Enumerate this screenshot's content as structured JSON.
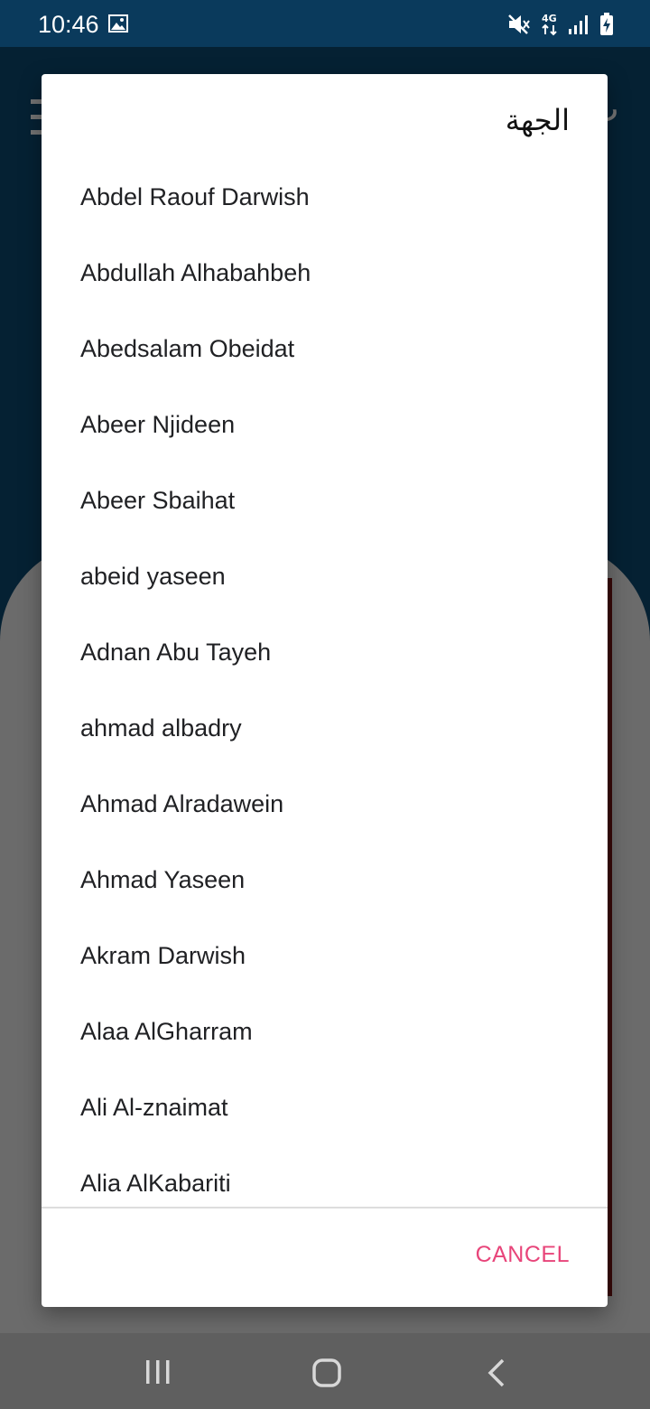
{
  "status": {
    "time": "10:46",
    "network": "4G"
  },
  "background": {
    "header_char": "ت"
  },
  "dialog": {
    "title": "الجهة",
    "items": [
      "Abdel Raouf Darwish",
      "Abdullah Alhabahbeh",
      "Abedsalam Obeidat",
      "Abeer Njideen",
      "Abeer Sbaihat",
      "abeid yaseen",
      "Adnan Abu Tayeh",
      "ahmad albadry",
      "Ahmad Alradawein",
      "Ahmad Yaseen",
      "Akram Darwish",
      "Alaa AlGharram",
      "Ali Al-znaimat",
      "Alia AlKabariti"
    ],
    "cancel_label": "CANCEL"
  },
  "colors": {
    "accent": "#e8457a",
    "header": "#0d4a72",
    "statusbar": "#0a3a5c"
  },
  "icons": [
    "image-icon",
    "mute-icon",
    "network-4g-icon",
    "signal-icon",
    "battery-charging-icon",
    "menu-icon",
    "recents-icon",
    "home-icon",
    "back-icon"
  ]
}
